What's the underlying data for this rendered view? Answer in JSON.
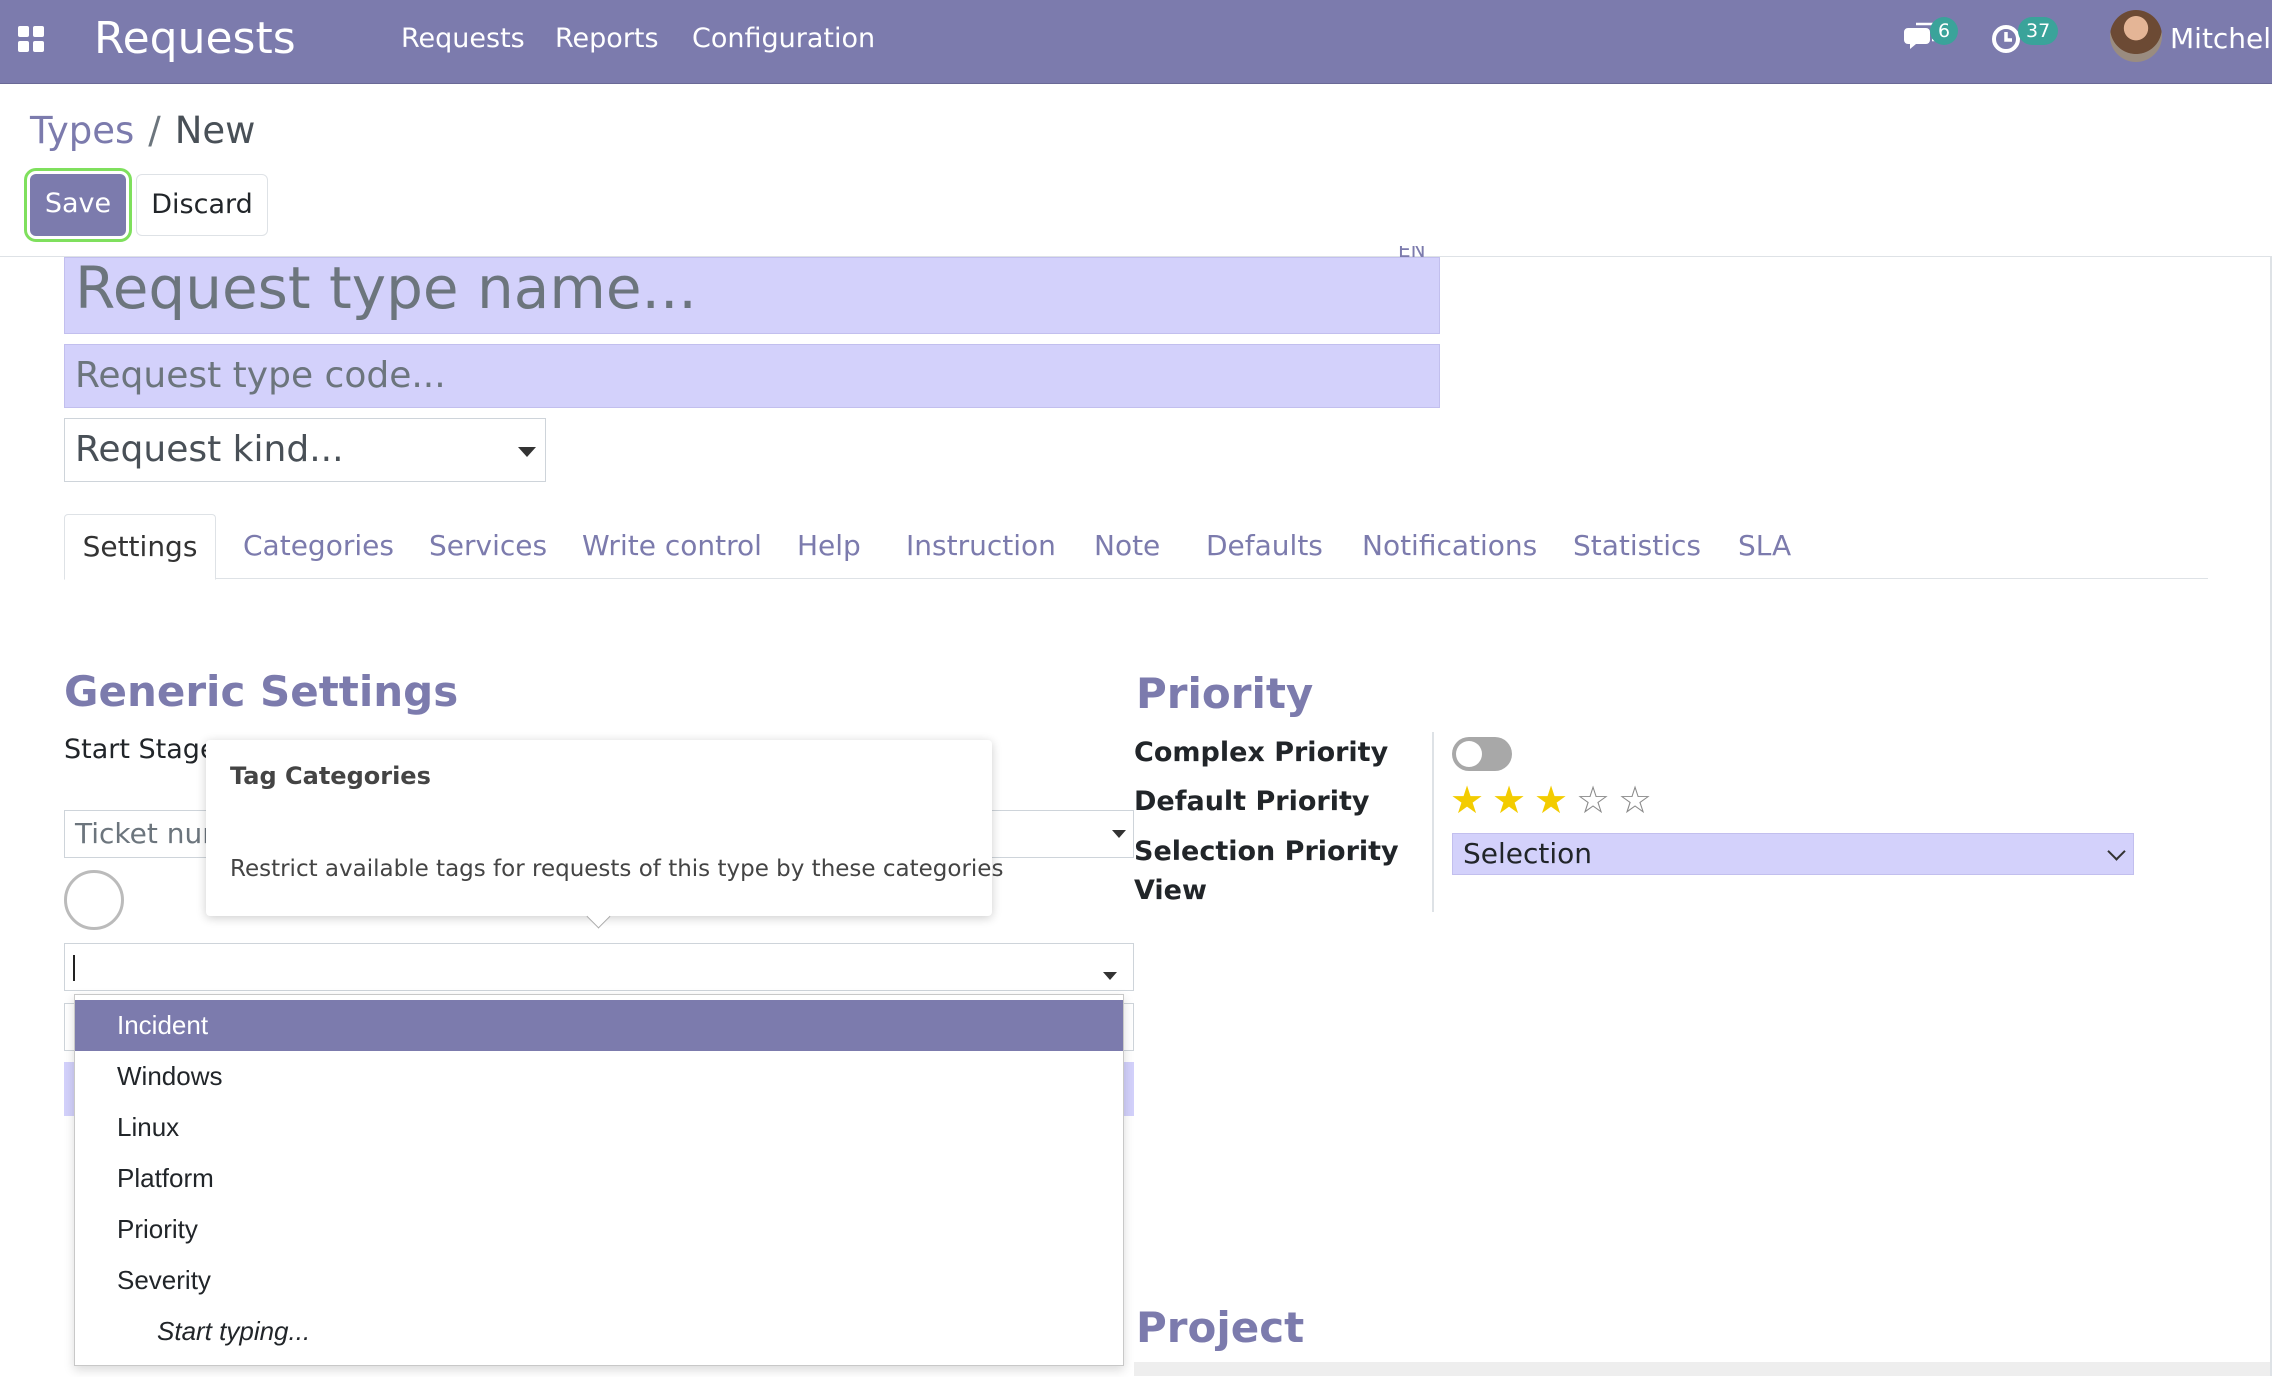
{
  "navbar": {
    "app_title": "Requests",
    "menu": [
      "Requests",
      "Reports",
      "Configuration"
    ],
    "messages_count": "6",
    "activities_count": "37",
    "user_name": "Mitchell"
  },
  "breadcrumb": {
    "parent": "Types",
    "separator": "/",
    "current": "New"
  },
  "buttons": {
    "save": "Save",
    "discard": "Discard"
  },
  "form": {
    "lang_code": "EN",
    "name_placeholder": "Request type name...",
    "code_placeholder": "Request type code...",
    "kind_placeholder": "Request kind..."
  },
  "tabs": [
    "Settings",
    "Categories",
    "Services",
    "Write control",
    "Help",
    "Instruction",
    "Note",
    "Defaults",
    "Notifications",
    "Statistics",
    "SLA"
  ],
  "generic_settings": {
    "title": "Generic Settings",
    "start_stage_label": "Start Stage",
    "ticket_number_placeholder": "Ticket num"
  },
  "tooltip": {
    "title": "Tag Categories",
    "help": "Restrict available tags for requests of this type by these categories"
  },
  "tag_dropdown": {
    "items": [
      "Incident",
      "Windows",
      "Linux",
      "Platform",
      "Priority",
      "Severity"
    ],
    "start_typing": "Start typing..."
  },
  "priority": {
    "title": "Priority",
    "complex_priority_label": "Complex Priority",
    "complex_priority_on": false,
    "default_priority_label": "Default Priority",
    "default_priority_value": 3,
    "default_priority_max": 5,
    "selection_priority_label_1": "Selection Priority",
    "selection_priority_label_2": "View",
    "selection_value": "Selection"
  },
  "project": {
    "title": "Project"
  },
  "colors": {
    "brand": "#7c7bad",
    "field_highlight": "#d3d1fb",
    "badge": "#3aa39a",
    "save_focus": "#7fe05d",
    "star": "#f3cc00"
  },
  "icons": [
    "apps-grid-icon",
    "chat-icon",
    "clock-icon",
    "caret-down-icon",
    "chevron-down-icon",
    "star-icon"
  ]
}
